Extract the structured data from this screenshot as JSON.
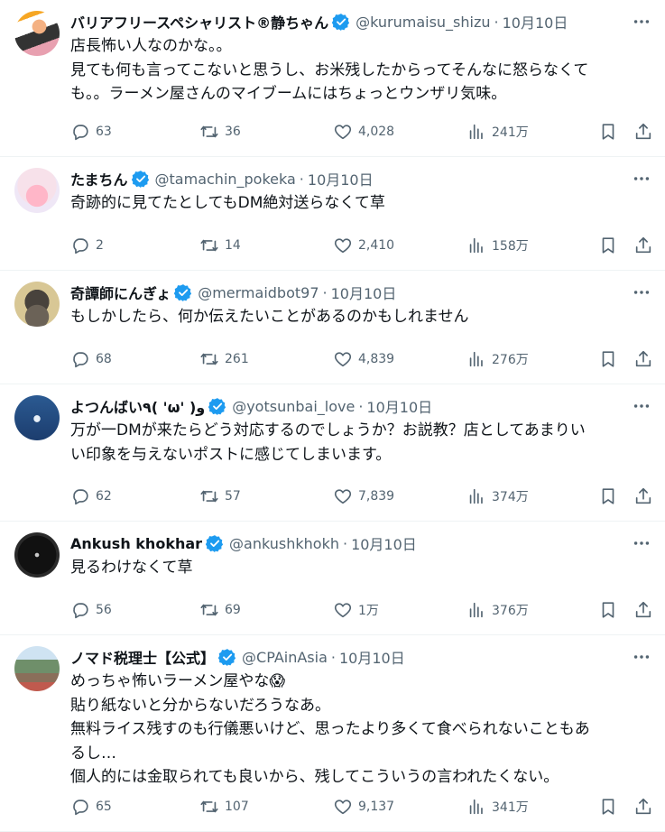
{
  "tweets": [
    {
      "name": "バリアフリースペシャリスト®静ちゃん",
      "handle": "@kurumaisu_shizu",
      "time": "10月10日",
      "lines": [
        "店長怖い人なのかな。。",
        "見ても何も言ってこないと思うし、お米残したからってそんなに怒らなくて",
        "も。。ラーメン屋さんのマイブームにはちょっとウンザリ気味。"
      ],
      "replies": "63",
      "retweets": "36",
      "likes": "4,028",
      "views": "241万"
    },
    {
      "name": "たまちん",
      "handle": "@tamachin_pokeka",
      "time": "10月10日",
      "lines": [
        "奇跡的に見てたとしてもDM絶対送らなくて草"
      ],
      "replies": "2",
      "retweets": "14",
      "likes": "2,410",
      "views": "158万"
    },
    {
      "name": "奇譚師にんぎょ",
      "handle": "@mermaidbot97",
      "time": "10月10日",
      "lines": [
        "もしかしたら、何か伝えたいことがあるのかもしれません"
      ],
      "replies": "68",
      "retweets": "261",
      "likes": "4,839",
      "views": "276万"
    },
    {
      "name": "よつんばい٩( 'ω' )و",
      "handle": "@yotsunbai_love",
      "time": "10月10日",
      "lines": [
        "万が一DMが来たらどう対応するのでしょうか？お説教？店としてあまりい",
        "い印象を与えないポストに感じてしまいます。"
      ],
      "replies": "62",
      "retweets": "57",
      "likes": "7,839",
      "views": "374万"
    },
    {
      "name": "Ankush khokhar",
      "handle": "@ankushkhokh",
      "time": "10月10日",
      "lines": [
        "見るわけなくて草"
      ],
      "replies": "56",
      "retweets": "69",
      "likes": "1万",
      "views": "376万"
    },
    {
      "name": "ノマド税理士【公式】",
      "handle": "@CPAinAsia",
      "time": "10月10日",
      "lines": [
        "めっちゃ怖いラーメン屋やな😱",
        "貼り紙ないと分からないだろうなあ。",
        "無料ライス残すのも行儀悪いけど、思ったより多くて食べられないこともあ",
        "るし…",
        "個人的には金取られても良いから、残してこういうの言われたくない。"
      ],
      "replies": "65",
      "retweets": "107",
      "likes": "9,137",
      "views": "341万"
    }
  ],
  "colors": {
    "text": "#0f1419",
    "muted": "#536471",
    "verified": "#1d9bf0",
    "divider": "#eff3f4"
  }
}
